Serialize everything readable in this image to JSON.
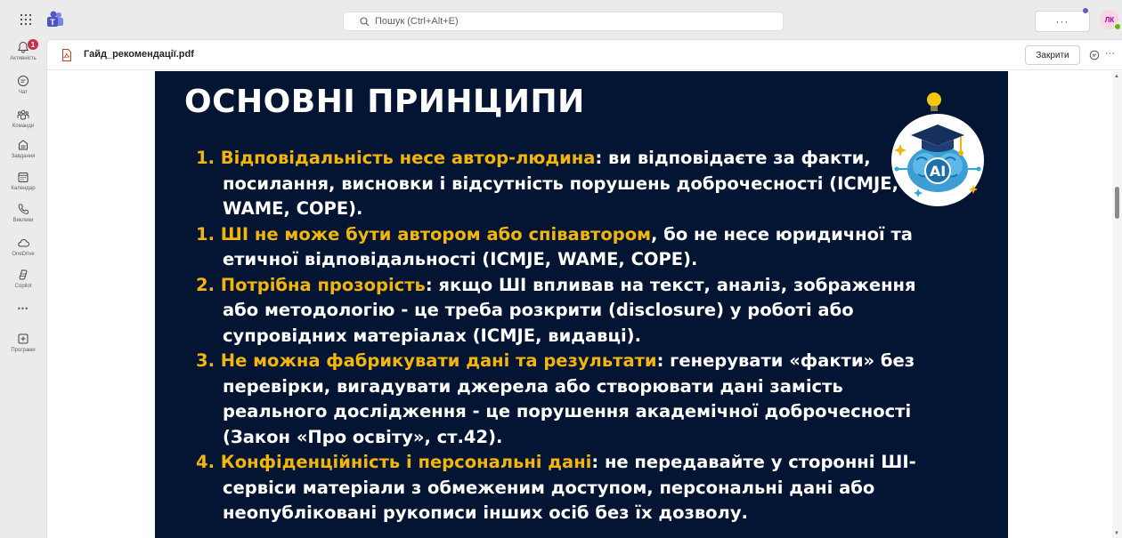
{
  "topbar": {
    "search_placeholder": "Пошук (Ctrl+Alt+E)",
    "more_label": "···",
    "avatar_initials": "ЛК",
    "avatar_color": "#b4009e",
    "presence_color": "#6bb700"
  },
  "rail": {
    "notification_count": "1",
    "items": [
      {
        "label": "Активність",
        "icon": "bell-icon"
      },
      {
        "label": "Чат",
        "icon": "chat-icon"
      },
      {
        "label": "Команди",
        "icon": "teams-icon"
      },
      {
        "label": "Завдання",
        "icon": "tasks-icon"
      },
      {
        "label": "Календар",
        "icon": "calendar-icon"
      },
      {
        "label": "Виклики",
        "icon": "phone-icon"
      },
      {
        "label": "OneDrive",
        "icon": "cloud-icon"
      },
      {
        "label": "Copilot",
        "icon": "copilot-icon"
      },
      {
        "label": "•••",
        "icon": "more-icon"
      },
      {
        "label": "Програми",
        "icon": "apps-add-icon"
      }
    ]
  },
  "file": {
    "name": "Гайд_рекомендації.pdf",
    "close_label": "Закрити",
    "more_label": "···"
  },
  "slide": {
    "title": "ОСНОВНІ ПРИНЦИПИ",
    "emblem_text": "AI",
    "accent_color": "#f2b50d",
    "background_color": "#041433",
    "principles": [
      {
        "num": "1.",
        "highlight": "Відповідальність несе автор-людина",
        "text": ": ви відповідаєте за факти, посилання, висновки і відсутність порушень доброчесності (ICMJE, WAME, COPE)."
      },
      {
        "num": "1.",
        "highlight": "ШІ не може бути автором або співавтором",
        "text": ", бо не несе юридичної та етичної відповідальності (ICMJE, WAME, COPE)."
      },
      {
        "num": "2. ",
        "highlight": "Потрібна прозорість",
        "text": ": якщо ШІ впливав на текст, аналіз, зображення або методологію - це треба розкрити (disclosure) у роботі або супровідних матеріалах (ICMJE, видавці)."
      },
      {
        "num": "3.",
        "highlight": "Не можна фабрикувати дані та результати",
        "text": ": генерувати «факти» без перевірки, вигадувати джерела або створювати дані замість реального дослідження - це порушення академічної доброчесності (Закон «Про освіту», ст.42)."
      },
      {
        "num": "4.",
        "highlight": "Конфіденційність і персональні дані",
        "text": ": не передавайте у сторонні ШІ-сервіси матеріали з обмеженим доступом, персональні дані або неопубліковані рукописи інших осіб без їх дозволу."
      }
    ]
  }
}
